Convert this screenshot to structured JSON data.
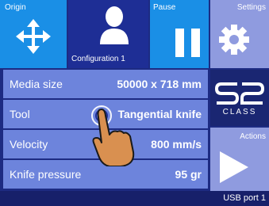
{
  "tiles": {
    "origin": {
      "label": "Origin",
      "icon": "move-arrows-icon"
    },
    "config": {
      "label": "Configuration 1",
      "icon": "user-icon"
    },
    "pause": {
      "label": "Pause",
      "icon": "pause-icon"
    },
    "settings": {
      "label": "Settings",
      "icon": "gear-icon"
    },
    "logo": {
      "brand_text": "CLASS",
      "icon": "s2-logo"
    },
    "actions": {
      "label": "Actions",
      "icon": "play-icon"
    }
  },
  "parameters": [
    {
      "label": "Media size",
      "value": "50000 x 718 mm"
    },
    {
      "label": "Tool",
      "value": "Tangential knife"
    },
    {
      "label": "Velocity",
      "value": "800 mm/s"
    },
    {
      "label": "Knife pressure",
      "value": "95 gr"
    }
  ],
  "footer": {
    "port": "USB port 1"
  },
  "colors": {
    "background": "#1d2b82",
    "tile_blue": "#1a8fe6",
    "tile_dark": "#1e2e95",
    "tile_lavender": "#8f9bdf",
    "row": "#6d84dc"
  }
}
